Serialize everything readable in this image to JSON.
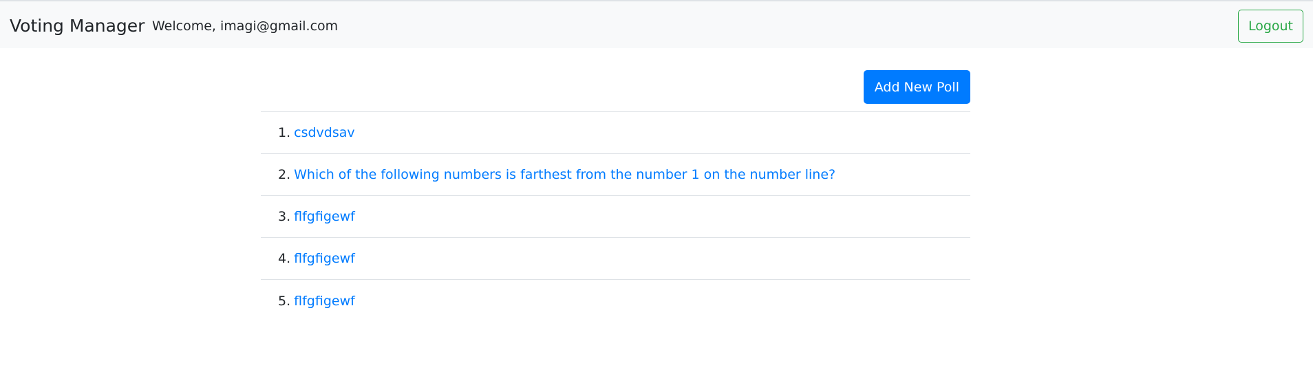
{
  "header": {
    "brand": "Voting Manager",
    "welcome": "Welcome, imagi@gmail.com",
    "logout_label": "Logout"
  },
  "toolbar": {
    "add_poll_label": "Add New Poll"
  },
  "polls": [
    {
      "number": "1.",
      "title": "csdvdsav"
    },
    {
      "number": "2.",
      "title": "Which of the following numbers is farthest from the number 1 on the number line?"
    },
    {
      "number": "3.",
      "title": "flfgfigewf"
    },
    {
      "number": "4.",
      "title": "flfgfigewf"
    },
    {
      "number": "5.",
      "title": "flfgfigewf"
    }
  ],
  "colors": {
    "primary": "#007bff",
    "success": "#28a745",
    "navbar_bg": "#f8f9fa",
    "divider": "#dee2e6"
  }
}
